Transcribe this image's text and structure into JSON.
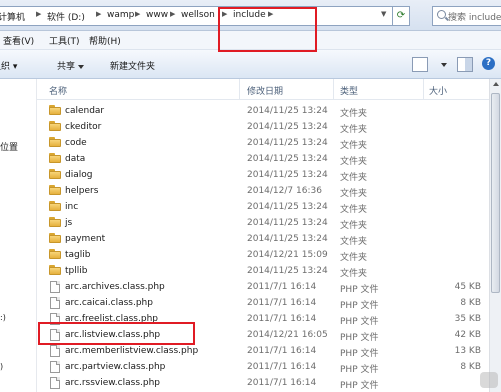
{
  "address": {
    "crumbs": [
      "计算机",
      "软件 (D:)",
      "wamp",
      "www",
      "wellson",
      "include"
    ],
    "search_placeholder": "搜索 include"
  },
  "menu": [
    "查看(V)",
    "工具(T)",
    "帮助(H)"
  ],
  "toolbar": {
    "organize": "组织 ▾",
    "share": "共享",
    "new_folder": "新建文件夹"
  },
  "nav": [
    "位置"
  ],
  "columns": {
    "name": "名称",
    "date": "修改日期",
    "type": "类型",
    "size": "大小"
  },
  "rows": [
    {
      "name": "calendar",
      "date": "2014/11/25 13:24",
      "type": "文件夹",
      "size": "",
      "icon": "folder-icon"
    },
    {
      "name": "ckeditor",
      "date": "2014/11/25 13:24",
      "type": "文件夹",
      "size": "",
      "icon": "folder-icon"
    },
    {
      "name": "code",
      "date": "2014/11/25 13:24",
      "type": "文件夹",
      "size": "",
      "icon": "folder-icon"
    },
    {
      "name": "data",
      "date": "2014/11/25 13:24",
      "type": "文件夹",
      "size": "",
      "icon": "folder-icon"
    },
    {
      "name": "dialog",
      "date": "2014/11/25 13:24",
      "type": "文件夹",
      "size": "",
      "icon": "folder-icon"
    },
    {
      "name": "helpers",
      "date": "2014/12/7 16:36",
      "type": "文件夹",
      "size": "",
      "icon": "folder-icon"
    },
    {
      "name": "inc",
      "date": "2014/11/25 13:24",
      "type": "文件夹",
      "size": "",
      "icon": "folder-icon"
    },
    {
      "name": "js",
      "date": "2014/11/25 13:24",
      "type": "文件夹",
      "size": "",
      "icon": "folder-icon"
    },
    {
      "name": "payment",
      "date": "2014/11/25 13:24",
      "type": "文件夹",
      "size": "",
      "icon": "folder-icon"
    },
    {
      "name": "taglib",
      "date": "2014/12/21 15:09",
      "type": "文件夹",
      "size": "",
      "icon": "folder-icon"
    },
    {
      "name": "tpllib",
      "date": "2014/11/25 13:24",
      "type": "文件夹",
      "size": "",
      "icon": "folder-icon"
    },
    {
      "name": "arc.archives.class.php",
      "date": "2011/7/1 16:14",
      "type": "PHP 文件",
      "size": "45 KB",
      "icon": "file-icon"
    },
    {
      "name": "arc.caicai.class.php",
      "date": "2011/7/1 16:14",
      "type": "PHP 文件",
      "size": "8 KB",
      "icon": "file-icon"
    },
    {
      "name": "arc.freelist.class.php",
      "date": "2011/7/1 16:14",
      "type": "PHP 文件",
      "size": "35 KB",
      "icon": "file-icon"
    },
    {
      "name": "arc.listview.class.php",
      "date": "2014/12/21 16:05",
      "type": "PHP 文件",
      "size": "42 KB",
      "icon": "file-icon"
    },
    {
      "name": "arc.memberlistview.class.php",
      "date": "2011/7/1 16:14",
      "type": "PHP 文件",
      "size": "13 KB",
      "icon": "file-icon"
    },
    {
      "name": "arc.partview.class.php",
      "date": "2011/7/1 16:14",
      "type": "PHP 文件",
      "size": "8 KB",
      "icon": "file-icon"
    },
    {
      "name": "arc.rssview.class.php",
      "date": "2011/7/1 16:14",
      "type": "PHP 文件",
      "size": "",
      "icon": "file-icon"
    }
  ]
}
